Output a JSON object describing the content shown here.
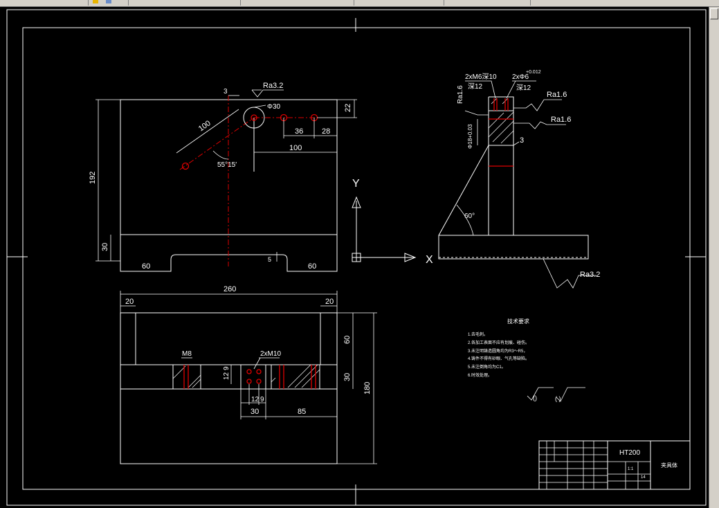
{
  "toolbar": {
    "tabs": [
      "",
      "",
      "",
      "",
      "",
      ""
    ]
  },
  "drawing": {
    "top_view": {
      "ra_label": "Ra3.2",
      "dim_3": "3",
      "dim_phi30": "Φ30",
      "dim_22": "22",
      "dim_100_diag": "100",
      "dim_36": "36",
      "dim_28": "28",
      "dim_100": "100",
      "angle": "55°15′",
      "dim_192": "192",
      "dim_30": "30",
      "dim_60_left": "60",
      "dim_60_right": "60",
      "dim_5": "5"
    },
    "axes": {
      "y": "Y",
      "x": "X"
    },
    "side_view": {
      "holes_label": "2xM6深10",
      "holes_depth": "深12",
      "pins_label": "2xΦ6",
      "pins_tol": "+0.012",
      "pins_depth": "深12",
      "ra16_left": "Ra1.6",
      "ra16_a": "Ra1.6",
      "ra16_b": "Ra1.6",
      "phi_tol": "Φ18+0.03",
      "dim_3": "3",
      "angle": "60°",
      "ra32": "Ra3.2"
    },
    "front_view": {
      "dim_260": "260",
      "dim_20_left": "20",
      "dim_20_right": "20",
      "dim_60": "60",
      "m8": "M8",
      "m10": "2xM10",
      "dim_12": "12",
      "dim_9": "9",
      "dim_30_v": "30",
      "dim_180": "180",
      "dim_12b": "12",
      "dim_9b": "9",
      "dim_30_h": "30",
      "dim_85": "85"
    },
    "tech_notes": {
      "title": "技术要求",
      "items": [
        "1.去毛刺。",
        "2.各加工表面不应有划痕、碰伤。",
        "3.未注明铸造圆角均为R3～R5，",
        "4.铸件不得有砂眼、气孔等缺陷。",
        "5.未注倒角均为C1。",
        "6.时效处理。"
      ],
      "roughness_left": "()",
      "roughness_right": "( )"
    },
    "title_block": {
      "material": "HT200",
      "part_name": "夹具体",
      "scale": "1:1",
      "sheet": "14"
    }
  }
}
